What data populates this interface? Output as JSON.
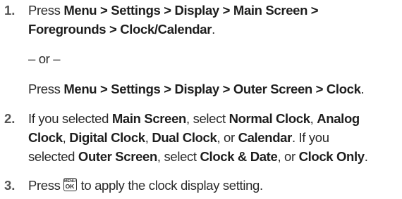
{
  "steps": [
    {
      "number": "1.",
      "line1": {
        "prefix": "Press ",
        "path": "Menu > Settings > Display > Main Screen >"
      },
      "line2": {
        "path": "Foregrounds > Clock/Calendar",
        "suffix": "."
      },
      "or_text": "– or –",
      "line3": {
        "prefix": "Press ",
        "path": "Menu > Settings > Display > Outer Screen > Clock",
        "suffix": "."
      }
    },
    {
      "number": "2.",
      "line1": {
        "t1": "If you selected ",
        "b1": "Main Screen",
        "t2": ", select ",
        "b2": "Normal Clock",
        "t3": ", ",
        "b3": "Analog"
      },
      "line2": {
        "b1": "Clock",
        "t1": ", ",
        "b2": "Digital Clock",
        "t2": ", ",
        "b3": "Dual Clock",
        "t3": ", or ",
        "b4": "Calendar",
        "t4": ". If you"
      },
      "line3": {
        "t1": "selected ",
        "b1": "Outer Screen",
        "t2": ", select ",
        "b2": "Clock & Date",
        "t3": ", or ",
        "b3": "Clock Only",
        "t4": "."
      }
    },
    {
      "number": "3.",
      "prefix": "Press",
      "key_icon": {
        "name": "menu-ok-key-icon",
        "top": "MENU",
        "bottom": "OK"
      },
      "suffix": "to apply the clock display setting."
    }
  ]
}
